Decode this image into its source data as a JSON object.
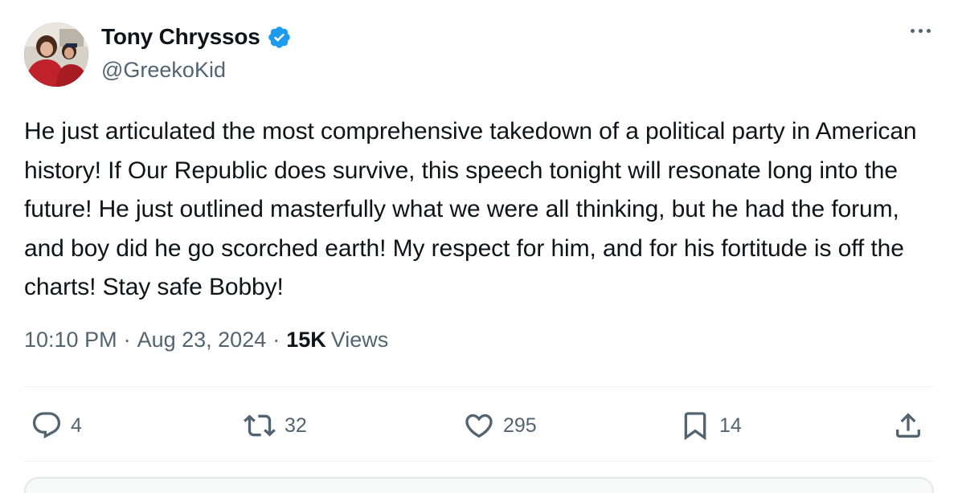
{
  "author": {
    "display_name": "Tony Chryssos",
    "handle": "@GreekoKid",
    "verified": true
  },
  "tweet": {
    "text": "He just articulated the most comprehensive takedown of a political party in American history! If Our Republic does survive, this speech tonight will resonate long into the future! He just outlined masterfully what we were all thinking, but he had the forum, and boy did he go scorched earth! My respect for him, and for his fortitude is off the charts! Stay safe Bobby!",
    "time": "10:10 PM",
    "date": "Aug 23, 2024",
    "views_count": "15K",
    "views_label": "Views"
  },
  "actions": {
    "replies": "4",
    "reposts": "32",
    "likes": "295",
    "bookmarks": "14"
  },
  "icons": [
    "verified-badge-icon",
    "more-options-icon",
    "reply-icon",
    "repost-icon",
    "like-icon",
    "bookmark-icon",
    "share-icon"
  ],
  "colors": {
    "text": "#0f1419",
    "secondary": "#536471",
    "verified": "#1d9bf0",
    "divider": "#eff3f4"
  }
}
